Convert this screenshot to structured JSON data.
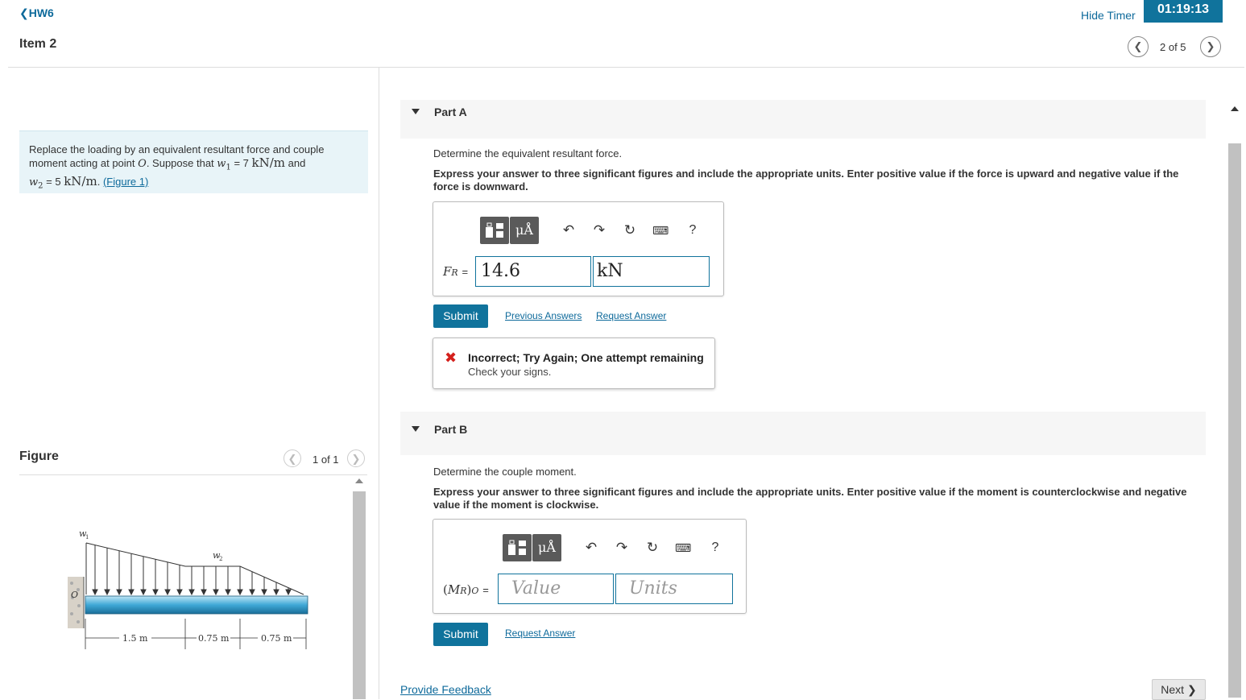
{
  "header": {
    "back_label": "HW6",
    "item_title": "Item 2",
    "hide_timer_label": "Hide Timer",
    "timer": "01:19:13",
    "item_counter": "2 of 5"
  },
  "problem": {
    "line1": "Replace the loading by an equivalent resultant force and couple",
    "line2_pre": "moment acting at point",
    "point": "O",
    "line2_mid": ". Suppose that",
    "w1_sym": "w",
    "w1_sub": "1",
    "eq": "= 7",
    "unit_kn_m": "kN/m",
    "and": "and",
    "w2_sym": "w",
    "w2_sub": "2",
    "eq2": "= 5",
    "unit2": "kN/m",
    "dot": ".",
    "figure_link": "(Figure 1)"
  },
  "figure": {
    "title": "Figure",
    "counter": "1 of 1",
    "labels": {
      "w1": "w",
      "w1_sub": "1",
      "w2": "w",
      "w2_sub": "2",
      "o": "O",
      "d1": "1.5 m",
      "d2": "0.75 m",
      "d3": "0.75 m"
    }
  },
  "part_a": {
    "label": "Part A",
    "question": "Determine the equivalent resultant force.",
    "instructions": "Express your answer to three significant figures and include the appropriate units. Enter positive value if the force is upward and negative value if the force is downward.",
    "var_main": "F",
    "var_sub": "R",
    "var_eq": "=",
    "value": "14.6",
    "units": "kN",
    "submit": "Submit",
    "prev_answers": "Previous Answers",
    "request_answer": "Request Answer",
    "feedback_title": "Incorrect; Try Again; One attempt remaining",
    "feedback_msg": "Check your signs."
  },
  "part_b": {
    "label": "Part B",
    "question": "Determine the couple moment.",
    "instructions": "Express your answer to three significant figures and include the appropriate units. Enter positive value if the moment is counterclockwise and negative value if the moment is clockwise.",
    "var_open": "(",
    "var_main": "M",
    "var_sub": "R",
    "var_close": ")",
    "var_sub2": "O",
    "var_eq": "=",
    "value_placeholder": "Value",
    "units_placeholder": "Units",
    "submit": "Submit",
    "request_answer": "Request Answer"
  },
  "toolbar": {
    "units_glyph": "μÅ",
    "help": "?"
  },
  "footer": {
    "provide_feedback": "Provide Feedback",
    "next": "Next"
  }
}
